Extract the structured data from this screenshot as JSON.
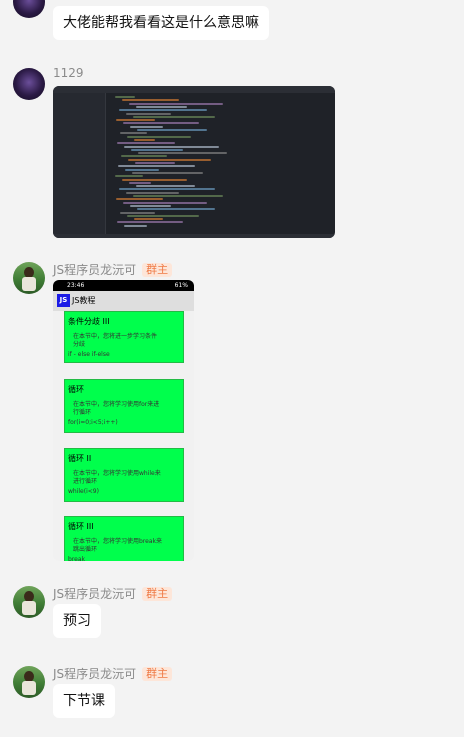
{
  "messages": [
    {
      "id": "m1",
      "text": "大佬能帮我看看这是什么意思嘛"
    },
    {
      "id": "m2",
      "sender": "1129"
    },
    {
      "id": "m3",
      "sender": "JS程序员龙沅可",
      "badge": "群主"
    },
    {
      "id": "m4",
      "sender": "JS程序员龙沅可",
      "badge": "群主",
      "text": "预习"
    },
    {
      "id": "m5",
      "sender": "JS程序员龙沅可",
      "badge": "群主",
      "text": "下节课"
    }
  ],
  "phone_shot": {
    "time": "23:46",
    "battery": "61%",
    "logo": "JS",
    "title": "JS教程",
    "cards": [
      {
        "heading": "条件分歧 III",
        "desc1": "在本节中，您将进一步学习条件",
        "desc2": "分歧",
        "code": "if - else if-else"
      },
      {
        "heading": "循环",
        "desc1": "在本节中，您将学习使用for来进",
        "desc2": "行循环",
        "code": "for(i=0;i<5;i++)"
      },
      {
        "heading": "循环 II",
        "desc1": "在本节中，您将学习使用while来",
        "desc2": "进行循环",
        "code": "while(i<9)"
      },
      {
        "heading": "循环 III",
        "desc1": "在本节中，您将学习使用break来",
        "desc2": "跳出循环",
        "code": "break"
      }
    ]
  },
  "colors": {
    "accent_green": "#00ff4c",
    "badge_bg": "#fde6d9",
    "badge_text": "#ef7a45",
    "ide_bg": "#1f2228"
  }
}
